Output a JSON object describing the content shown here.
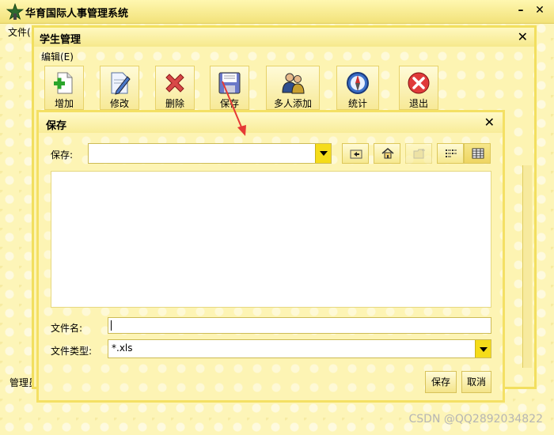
{
  "app": {
    "title": "华育国际人事管理系统",
    "menu_file": "文件(",
    "minimize": "–",
    "close": "✕",
    "footer_label": "管理员"
  },
  "student_window": {
    "title": "学生管理",
    "close": "✕",
    "menu_edit": "编辑(E)",
    "toolbar": [
      {
        "label": "增加",
        "icon": "add-document-icon"
      },
      {
        "label": "修改",
        "icon": "edit-document-icon"
      },
      {
        "label": "删除",
        "icon": "delete-x-icon"
      },
      {
        "label": "保存",
        "icon": "save-floppy-icon"
      },
      {
        "label": "多人添加",
        "icon": "users-group-icon"
      },
      {
        "label": "统计",
        "icon": "compass-icon"
      },
      {
        "label": "退出",
        "icon": "exit-stop-icon"
      }
    ]
  },
  "save_dialog": {
    "title": "保存",
    "close": "✕",
    "save_in_label": "保存:",
    "save_in_value": "",
    "nav_buttons": [
      {
        "icon": "up-folder-icon"
      },
      {
        "icon": "home-icon"
      },
      {
        "icon": "new-folder-icon"
      },
      {
        "icon": "list-view-icon"
      },
      {
        "icon": "details-view-icon"
      }
    ],
    "file_name_label": "文件名:",
    "file_name_value": "",
    "file_type_label": "文件类型:",
    "file_type_value": "*.xls",
    "save_button": "保存",
    "cancel_button": "取消"
  },
  "watermark": "CSDN @QQ2892034822",
  "colors": {
    "background": "#fdf5b8",
    "accent_yellow": "#f5dc1a",
    "annotation_arrow": "#e53935"
  }
}
